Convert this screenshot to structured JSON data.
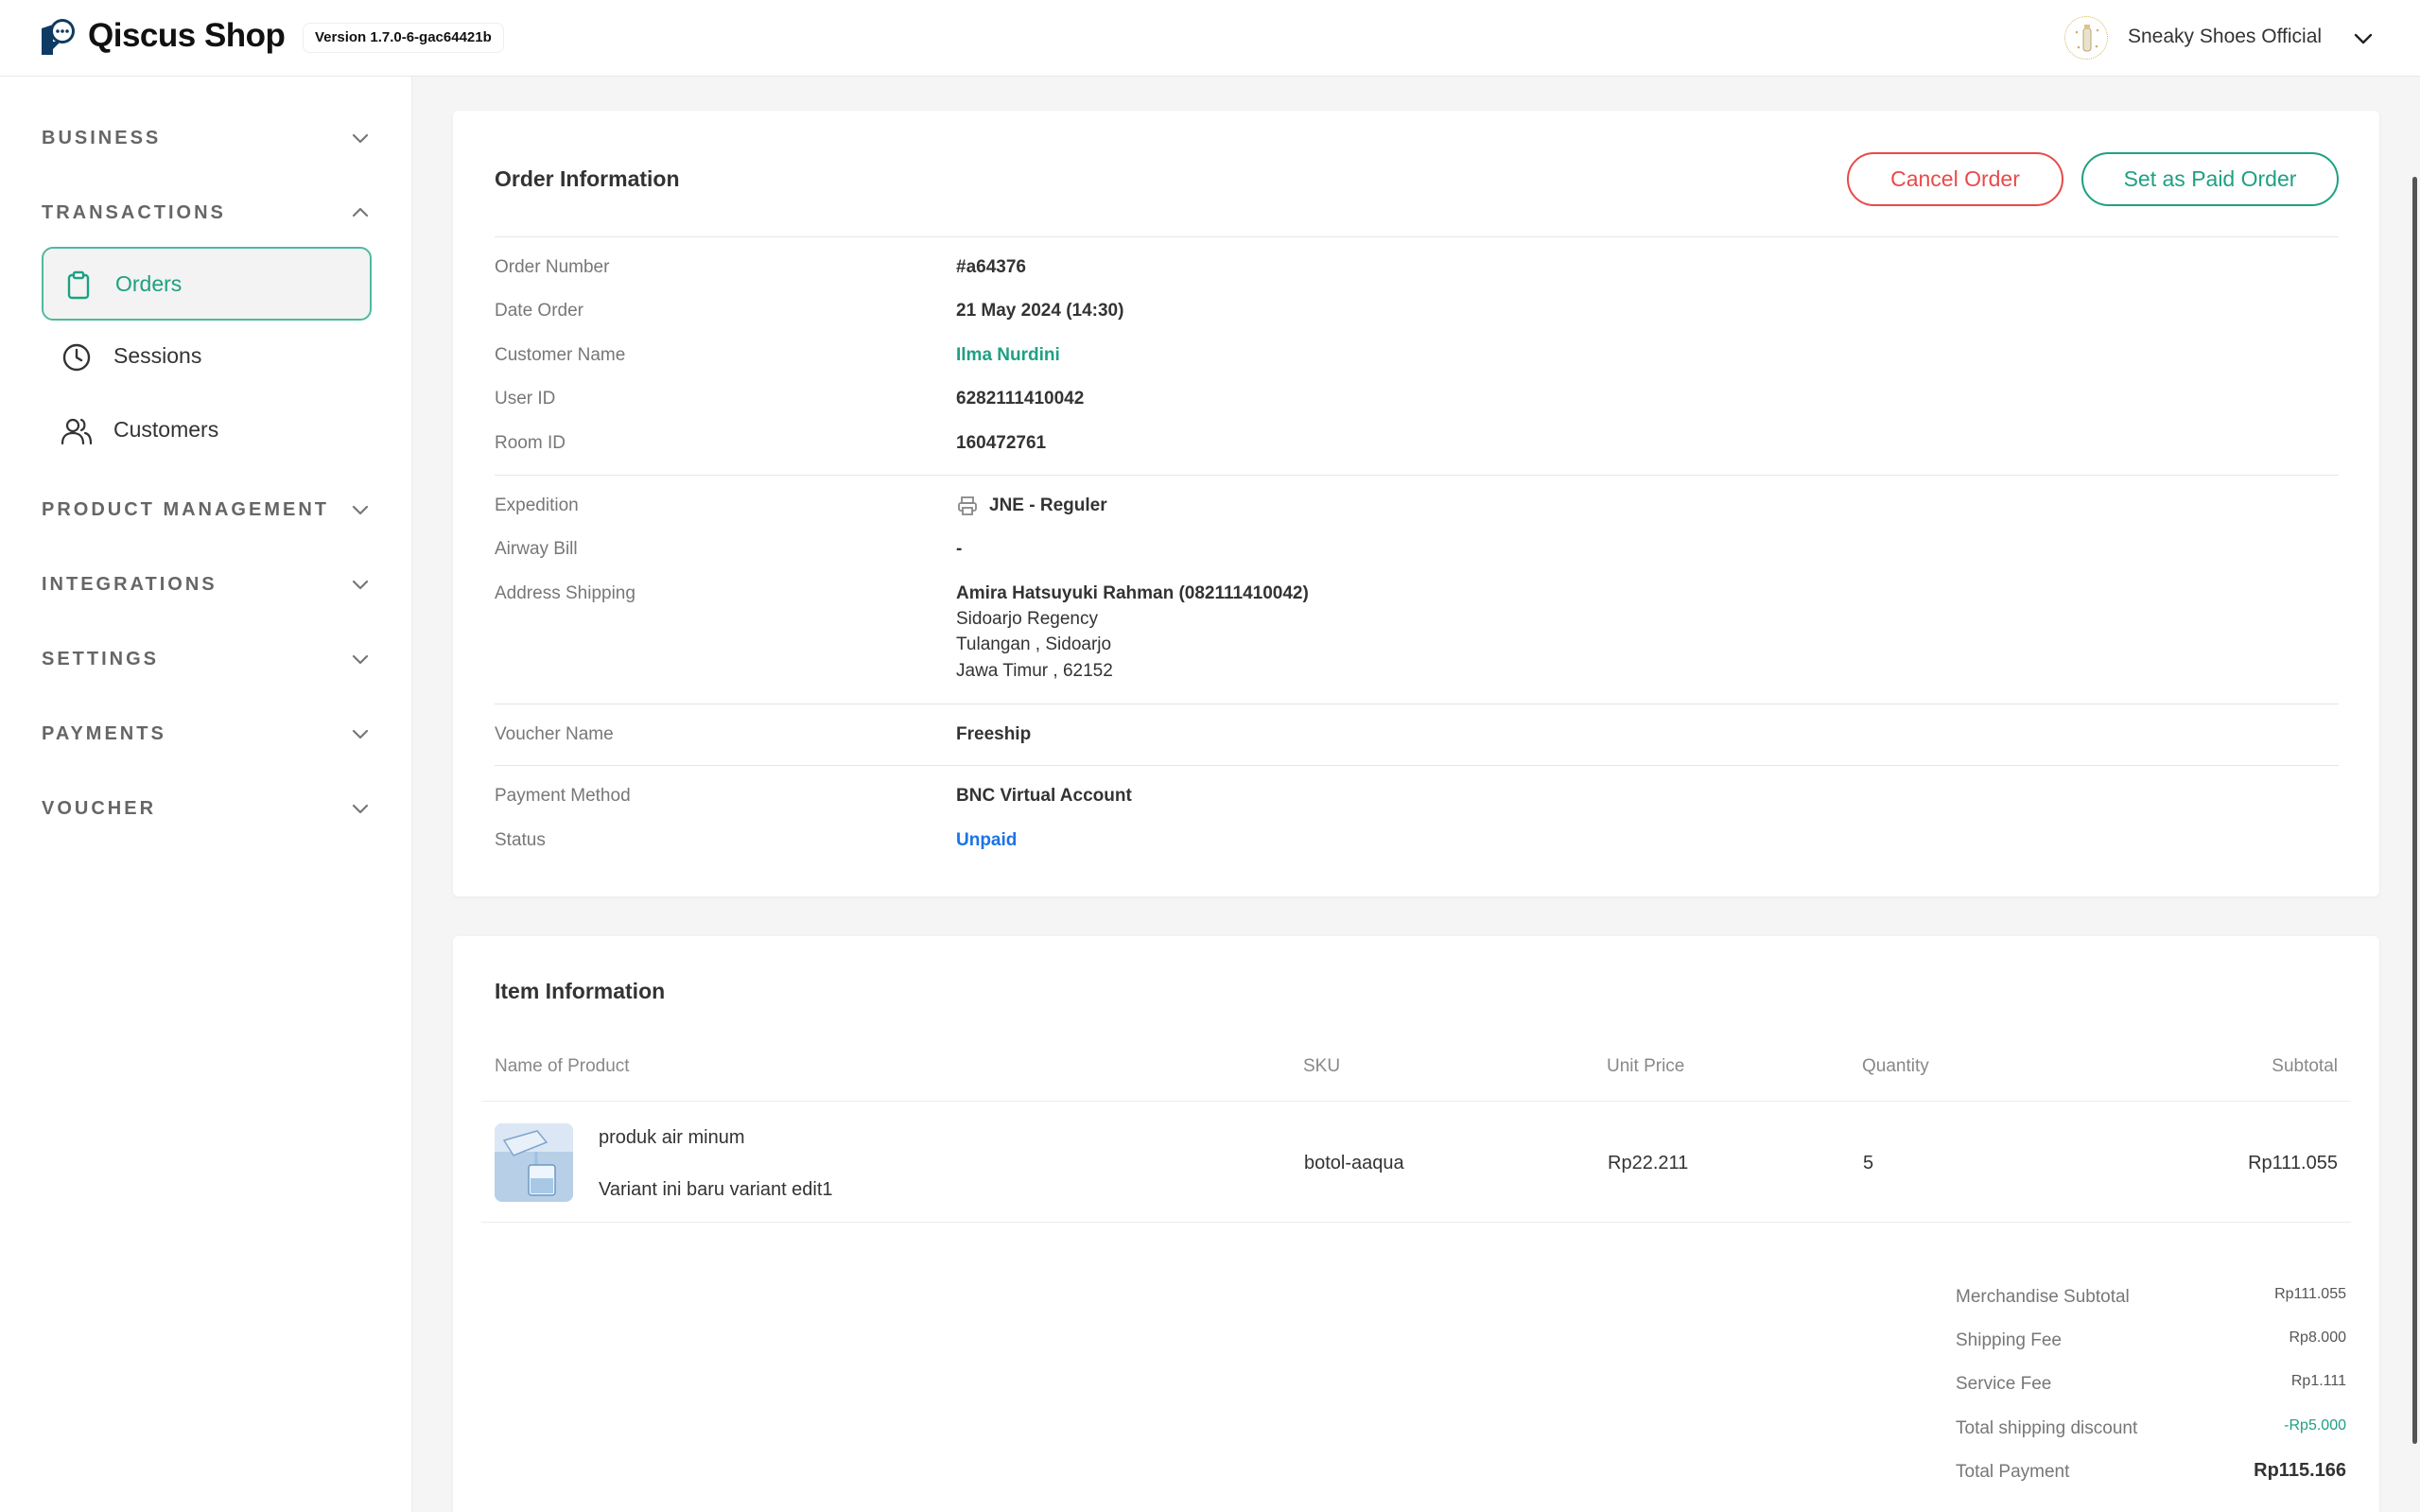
{
  "header": {
    "app_title": "Qiscus Shop",
    "version": "Version 1.7.0-6-gac64421b",
    "store_name": "Sneaky Shoes Official"
  },
  "sidebar": {
    "sections": [
      {
        "label": "BUSINESS",
        "expanded": false
      },
      {
        "label": "TRANSACTIONS",
        "expanded": true
      },
      {
        "label": "PRODUCT MANAGEMENT",
        "expanded": false
      },
      {
        "label": "INTEGRATIONS",
        "expanded": false
      },
      {
        "label": "SETTINGS",
        "expanded": false
      },
      {
        "label": "PAYMENTS",
        "expanded": false
      },
      {
        "label": "VOUCHER",
        "expanded": false
      }
    ],
    "transaction_items": [
      {
        "label": "Orders",
        "icon": "clipboard-icon",
        "active": true
      },
      {
        "label": "Sessions",
        "icon": "clock-icon",
        "active": false
      },
      {
        "label": "Customers",
        "icon": "users-icon",
        "active": false
      }
    ]
  },
  "order": {
    "title": "Order Information",
    "cancel_label": "Cancel Order",
    "paid_label": "Set as Paid Order",
    "order_number_label": "Order Number",
    "order_number": "#a64376",
    "date_label": "Date Order",
    "date": "21 May 2024 (14:30)",
    "customer_label": "Customer Name",
    "customer": "Ilma Nurdini",
    "user_id_label": "User ID",
    "user_id": "6282111410042",
    "room_id_label": "Room ID",
    "room_id": "160472761",
    "expedition_label": "Expedition",
    "expedition": "JNE - Reguler",
    "airway_label": "Airway Bill",
    "airway": "-",
    "address_label": "Address Shipping",
    "address_name": "Amira Hatsuyuki Rahman (082111410042)",
    "address_line1": "Sidoarjo Regency",
    "address_line2": "Tulangan , Sidoarjo",
    "address_line3": "Jawa Timur , 62152",
    "voucher_label": "Voucher Name",
    "voucher": "Freeship",
    "payment_label": "Payment Method",
    "payment": "BNC Virtual Account",
    "status_label": "Status",
    "status": "Unpaid",
    "colors": {
      "accent": "#1fa083",
      "danger": "#e84a4a",
      "status": "#1a73e8"
    }
  },
  "items": {
    "title": "Item Information",
    "columns": [
      "Name of Product",
      "SKU",
      "Unit Price",
      "Quantity",
      "Subtotal"
    ],
    "rows": [
      {
        "name": "produk air minum",
        "variant": "Variant ini baru variant edit1",
        "sku": "botol-aaqua",
        "unit_price": "Rp22.211",
        "quantity": "5",
        "subtotal": "Rp111.055"
      }
    ],
    "summary": {
      "merchandise_label": "Merchandise Subtotal",
      "merchandise": "Rp111.055",
      "shipping_label": "Shipping Fee",
      "shipping": "Rp8.000",
      "service_label": "Service Fee",
      "service": "Rp1.111",
      "discount_label": "Total shipping discount",
      "discount": "-Rp5.000",
      "total_label": "Total Payment",
      "total": "Rp115.166"
    }
  }
}
